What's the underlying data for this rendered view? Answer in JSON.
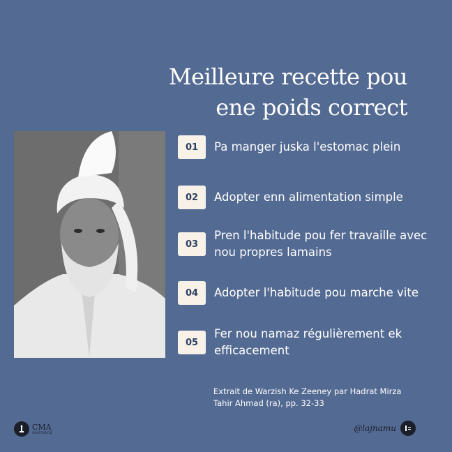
{
  "title": {
    "line1": "Meilleure recette pou",
    "line2": "ene poids correct"
  },
  "steps": [
    {
      "number": "01",
      "text": "Pa manger juska l'estomac plein"
    },
    {
      "number": "02",
      "text": "Adopter enn alimentation simple"
    },
    {
      "number": "03",
      "text": "Pren l'habitude pou fer travaille avec nou propres lamains"
    },
    {
      "number": "04",
      "text": "Adopter l'habitude pou marche vite"
    },
    {
      "number": "05",
      "text": "Fer nou namaz régulièrement ek efficacement"
    }
  ],
  "source": {
    "line1": "Extrait de Warzish Ke Zeeney par Hadrat Mirza",
    "line2": "Tahir Ahmad (ra), pp. 32-33"
  },
  "footer": {
    "logo_left_l1": "CMA",
    "logo_left_l2": "MAURICE",
    "handle": "@lajnamu"
  },
  "colors": {
    "background": "#536a92",
    "badge_bg": "#f7f1e8",
    "badge_text": "#2d3f60"
  }
}
